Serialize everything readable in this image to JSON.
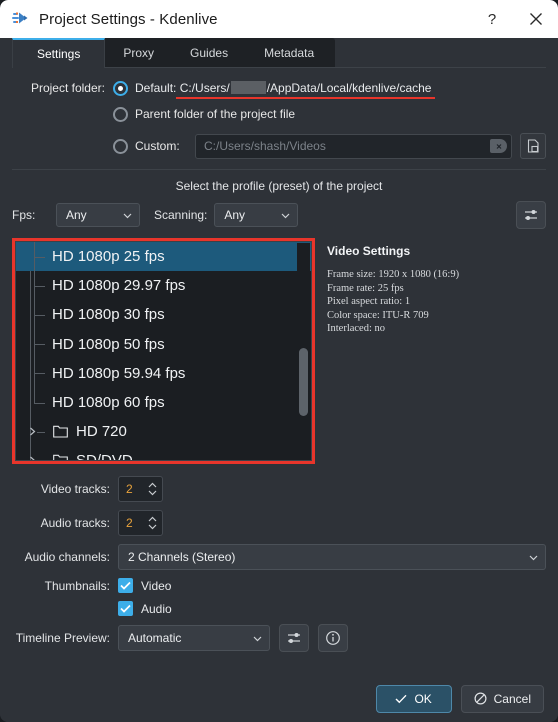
{
  "window": {
    "title": "Project Settings - Kdenlive",
    "app_icon": "kdenlive-icon",
    "help_label": "?",
    "close_label": "✕"
  },
  "tabs": [
    {
      "label": "Settings",
      "active": true
    },
    {
      "label": "Proxy",
      "active": false
    },
    {
      "label": "Guides",
      "active": false
    },
    {
      "label": "Metadata",
      "active": false
    }
  ],
  "project_folder": {
    "label": "Project folder:",
    "default": {
      "prefix": "Default: C:/Users/",
      "suffix": "/AppData/Local/kdenlive/cache",
      "selected": true,
      "redacted": true,
      "underline_color": "#e8352b"
    },
    "parent": {
      "label": "Parent folder of the project file",
      "selected": false
    },
    "custom": {
      "label": "Custom:",
      "selected": false,
      "placeholder": "C:/Users/shash/Videos",
      "value": "",
      "clear_icon": "clear-text-icon",
      "browse_icon": "open-folder-icon"
    }
  },
  "profile": {
    "caption": "Select the profile (preset) of the project",
    "fps_label": "Fps:",
    "fps_value": "Any",
    "scanning_label": "Scanning:",
    "scanning_value": "Any",
    "configure_icon": "sliders-icon",
    "highlight_color": "#e8352b",
    "tree": [
      {
        "label": "HD 1080p 25 fps",
        "type": "leaf",
        "selected": true
      },
      {
        "label": "HD 1080p 29.97 fps",
        "type": "leaf",
        "selected": false
      },
      {
        "label": "HD 1080p 30 fps",
        "type": "leaf",
        "selected": false
      },
      {
        "label": "HD 1080p 50 fps",
        "type": "leaf",
        "selected": false
      },
      {
        "label": "HD 1080p 59.94 fps",
        "type": "leaf",
        "selected": false
      },
      {
        "label": "HD 1080p 60 fps",
        "type": "leaf",
        "selected": false
      },
      {
        "label": "HD 720",
        "type": "folder",
        "selected": false
      },
      {
        "label": "SD/DVD",
        "type": "folder",
        "selected": false
      }
    ]
  },
  "video_settings": {
    "title": "Video Settings",
    "frame_size": "Frame size: 1920 x 1080 (16:9)",
    "frame_rate": "Frame rate: 25 fps",
    "pixel_aspect_ratio": "Pixel aspect ratio: 1",
    "color_space": "Color space: ITU-R 709",
    "interlaced": "Interlaced: no"
  },
  "tracks": {
    "video_label": "Video tracks:",
    "video_value": "2",
    "audio_label": "Audio tracks:",
    "audio_value": "2",
    "channels_label": "Audio channels:",
    "channels_value": "2 Channels (Stereo)"
  },
  "thumbnails": {
    "label": "Thumbnails:",
    "video_label": "Video",
    "video_checked": true,
    "audio_label": "Audio",
    "audio_checked": true
  },
  "timeline_preview": {
    "label": "Timeline Preview:",
    "value": "Automatic",
    "configure_icon": "sliders-icon",
    "info_icon": "info-icon"
  },
  "footer": {
    "ok_label": "OK",
    "ok_icon": "check-icon",
    "cancel_label": "Cancel",
    "cancel_icon": "no-entry-icon"
  }
}
